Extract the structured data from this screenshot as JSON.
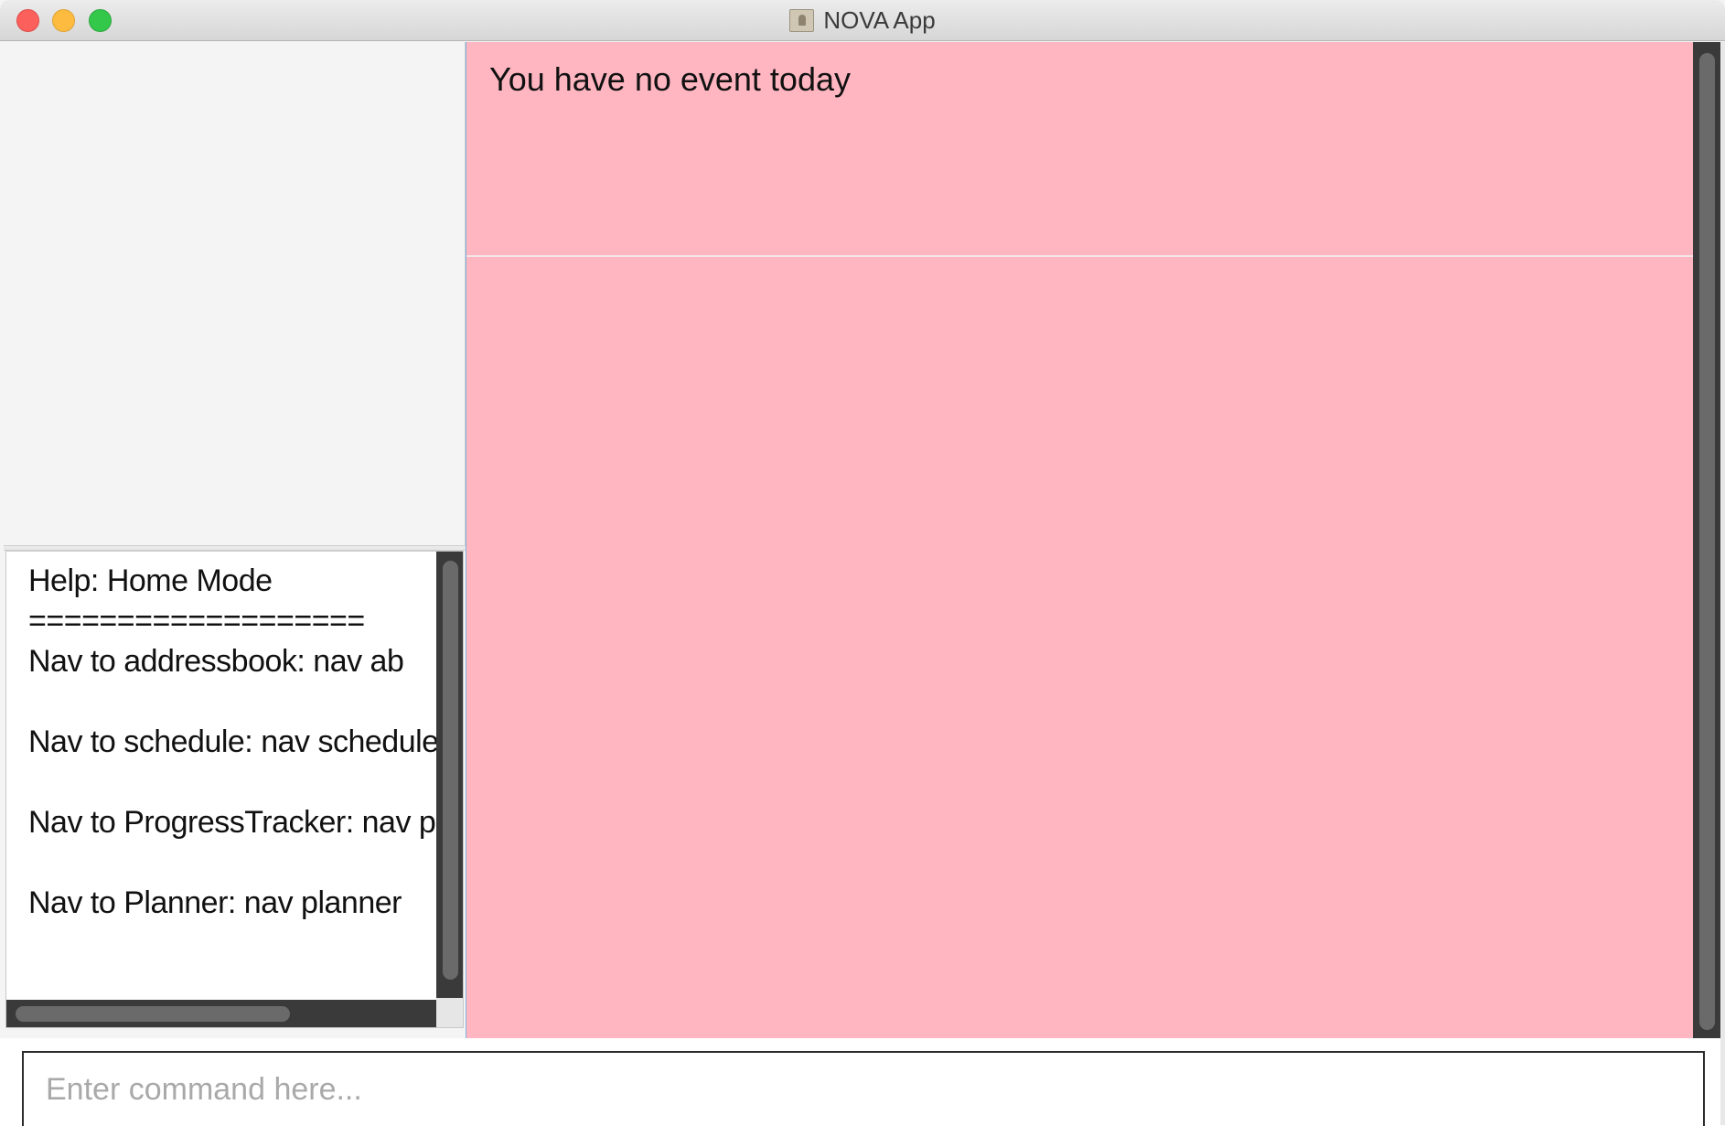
{
  "window": {
    "title": "NOVA App"
  },
  "event_panel": {
    "message": "You have no event today"
  },
  "help": {
    "lines": [
      "Help: Home Mode",
      "===================",
      "Nav to addressbook: nav ab",
      "",
      "Nav to schedule: nav schedule",
      "",
      "Nav to ProgressTracker: nav progress",
      "",
      "Nav to Planner: nav planner"
    ]
  },
  "command": {
    "placeholder": "Enter command here...",
    "value": ""
  },
  "colors": {
    "event_background": "#ffb6c1",
    "scrollbar_track": "#3a3a3a",
    "scrollbar_thumb": "#6a6a6a"
  }
}
